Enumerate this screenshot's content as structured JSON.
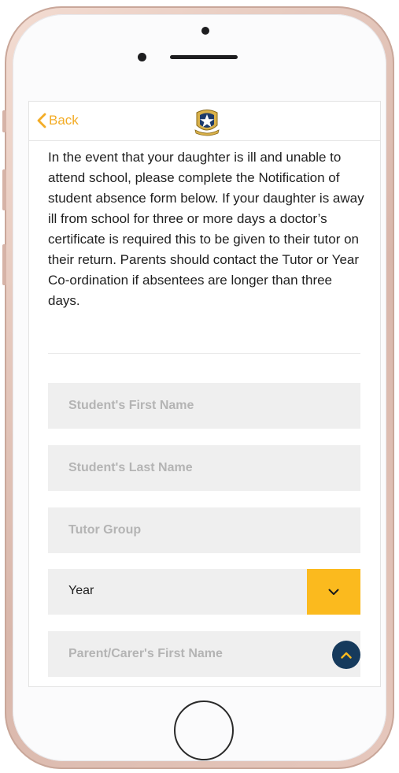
{
  "colors": {
    "accent": "#f3ac26",
    "select_button": "#fbba1e",
    "scroll_top_button": "#163a5c",
    "field_bg": "#efefef"
  },
  "nav": {
    "back_label": "Back",
    "back_icon": "chevron-left-icon",
    "logo": "school-crest-logo"
  },
  "intro": {
    "text": "In the event that your daughter is ill and unable to attend school, please complete the Notification of student absence form below. If your daughter is away ill from school for three or more days a doctor’s certificate is required this to be given to their tutor on their return. Parents should contact the Tutor or Year Co-ordination if absentees are longer than three days."
  },
  "form": {
    "first_name": {
      "placeholder": "Student's First Name",
      "value": ""
    },
    "last_name": {
      "placeholder": "Student's Last Name",
      "value": ""
    },
    "tutor_group": {
      "placeholder": "Tutor Group",
      "value": ""
    },
    "year": {
      "selected": "Year",
      "icon": "chevron-down-icon"
    },
    "parent_first_name": {
      "placeholder": "Parent/Carer's First Name",
      "value": ""
    }
  },
  "scroll_top": {
    "icon": "chevron-up-icon"
  }
}
